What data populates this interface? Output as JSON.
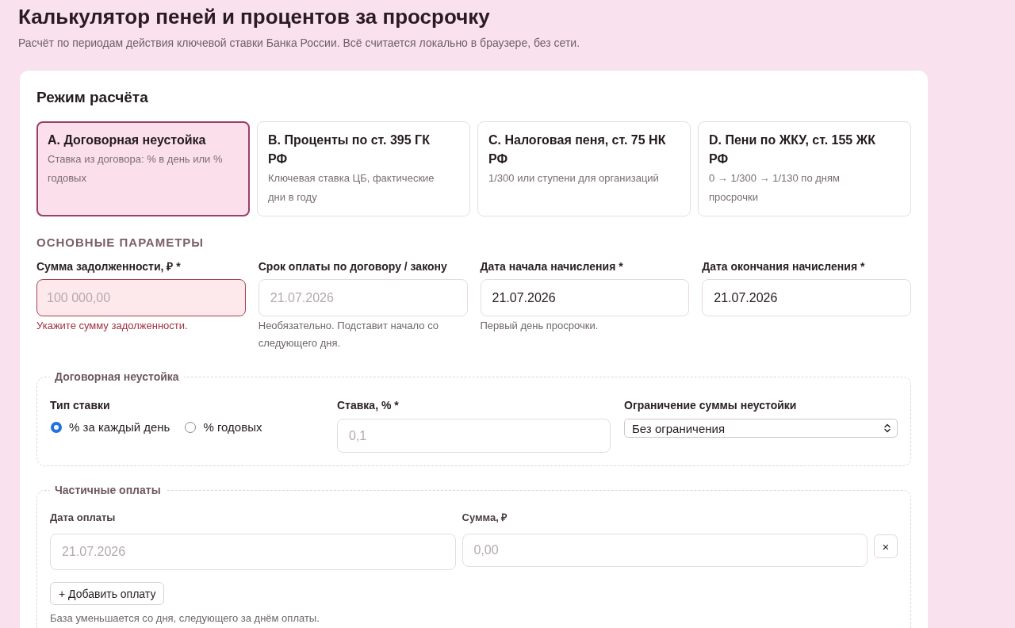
{
  "header": {
    "title": "Калькулятор пеней и процентов за просрочку",
    "subtitle": "Расчёт по периодам действия ключевой ставки Банка России. Всё считается локально в браузере, без сети."
  },
  "mode_section": {
    "title": "Режим расчёта",
    "modes": [
      {
        "title": "A. Договорная неустойка",
        "description": "Ставка из договора: % в день или % годовых",
        "selected": true
      },
      {
        "title": "B. Проценты по ст. 395 ГК РФ",
        "description": "Ключевая ставка ЦБ, фактические дни в году",
        "selected": false
      },
      {
        "title": "C. Налоговая пеня, ст. 75 НК РФ",
        "description": "1/300 или ступени для организаций",
        "selected": false
      },
      {
        "title": "D. Пени по ЖКУ, ст. 155 ЖК РФ",
        "description": "0 → 1/300 → 1/130 по дням просрочки",
        "selected": false
      }
    ]
  },
  "main_params": {
    "heading": "ОСНОВНЫЕ ПАРАМЕТРЫ",
    "fields": [
      {
        "label": "Сумма задолженности, ₽ *",
        "placeholder": "100 000,00",
        "invalid": true,
        "error": "Укажите сумму задолженности."
      },
      {
        "label": "Срок оплаты по договору / закону",
        "placeholder": "21.07.2026",
        "invalid": false,
        "hint": "Необязательно. Подставит начало со следующего дня."
      },
      {
        "label": "Дата начала начисления *",
        "value": "21.07.2026",
        "invalid": false,
        "hint": "Первый день просрочки."
      },
      {
        "label": "Дата окончания начисления *",
        "value": "21.07.2026",
        "invalid": false
      }
    ]
  },
  "penalty_group": {
    "legend": "Договорная неустойка",
    "rate_type": {
      "label": "Тип ставки",
      "options": [
        {
          "label": "% за каждый день",
          "selected": true
        },
        {
          "label": "% годовых",
          "selected": false
        }
      ]
    },
    "rate": {
      "label": "Ставка, % *",
      "placeholder": "0,1"
    },
    "limit": {
      "label": "Ограничение суммы неустойки",
      "value": "Без ограничения"
    }
  },
  "payments_group": {
    "legend": "Частичные оплаты",
    "columns": [
      "Дата оплаты",
      "Сумма, ₽"
    ],
    "rows": [
      {
        "date": {
          "placeholder": "21.07.2026"
        },
        "amount": {
          "placeholder": "0,00"
        },
        "remove_label": "×"
      }
    ],
    "add_button": "+ Добавить оплату",
    "note": "База уменьшается со дня, следующего за днём оплаты."
  }
}
